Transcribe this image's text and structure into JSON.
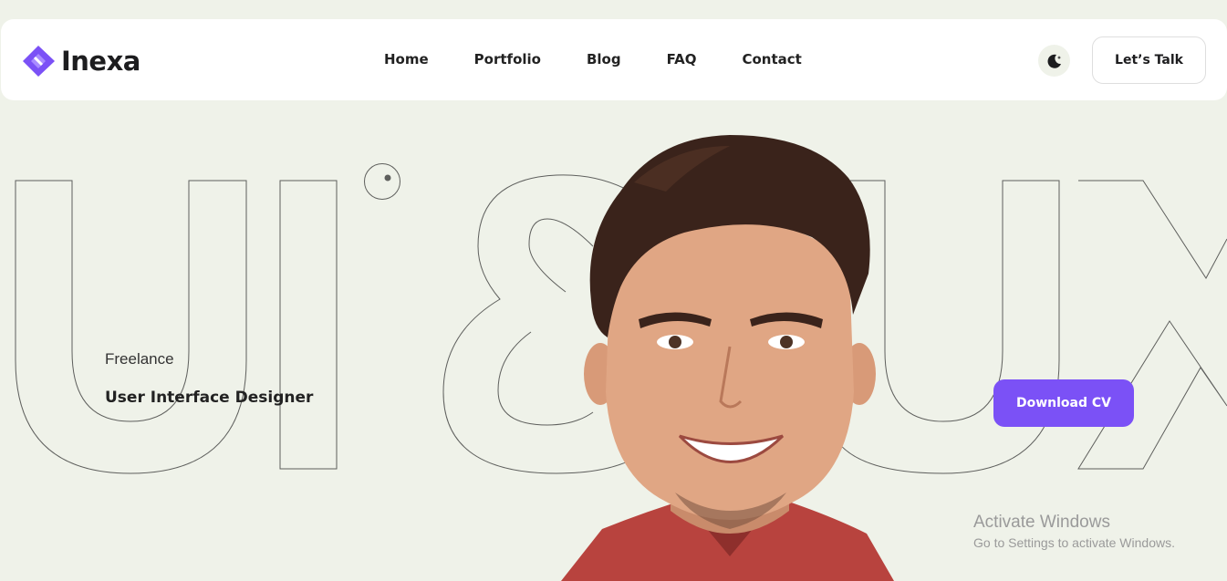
{
  "brand": {
    "name": "Inexa",
    "accent": "#7b51f6"
  },
  "nav": {
    "items": [
      {
        "label": "Home"
      },
      {
        "label": "Portfolio"
      },
      {
        "label": "Blog"
      },
      {
        "label": "FAQ"
      },
      {
        "label": "Contact"
      }
    ]
  },
  "header": {
    "theme_icon": "moon-icon",
    "cta_label": "Let’s Talk"
  },
  "hero": {
    "outline_text": "UI & UX",
    "subtitle": "Freelance",
    "role": "User Interface Designer",
    "cv_label": "Download CV",
    "image": "portrait-photo"
  },
  "watermark": {
    "title": "Activate Windows",
    "subtitle": "Go to Settings to activate Windows."
  }
}
